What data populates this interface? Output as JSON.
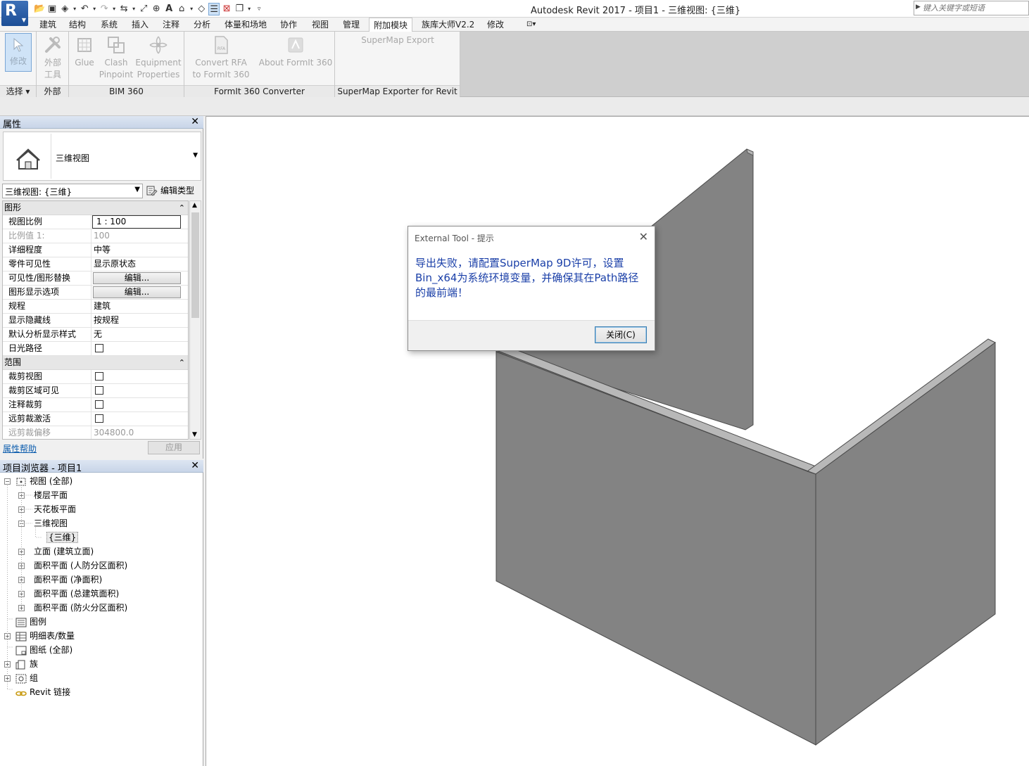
{
  "app": {
    "title": "Autodesk Revit 2017 -      项目1 - 三维视图: {三维}",
    "logo_letter": "R",
    "search_placeholder": "键入关键字或短语"
  },
  "ribbon_tabs": [
    "建筑",
    "结构",
    "系统",
    "插入",
    "注释",
    "分析",
    "体量和场地",
    "协作",
    "视图",
    "管理",
    "附加模块",
    "族库大师V2.2",
    "修改"
  ],
  "ribbon_selected_tab": "附加模块",
  "ribbon": {
    "modify_label": "修改",
    "select_panel": "选择",
    "external_tools_line1": "外部",
    "external_tools_line2": "工具",
    "external_panel": "外部",
    "glue": "Glue",
    "clash_line1": "Clash",
    "clash_line2": "Pinpoint",
    "equip_line1": "Equipment",
    "equip_line2": "Properties",
    "bim360_panel": "BIM 360",
    "convert_line1": "Convert RFA",
    "convert_line2": "to FormIt 360",
    "about_formit": "About FormIt 360",
    "formit_panel": "FormIt 360 Converter",
    "supermap_export": "SuperMap Export",
    "supermap_panel": "SuperMap Exporter for Revit"
  },
  "properties": {
    "title": "属性",
    "type_name": "三维视图",
    "instance": "三维视图: {三维}",
    "edit_type": "编辑类型",
    "groups": {
      "graphics": "图形",
      "extents": "范围"
    },
    "rows": {
      "view_scale": {
        "label": "视图比例",
        "value": "1 : 100"
      },
      "scale_value": {
        "label": "比例值 1:",
        "value": "100"
      },
      "detail_level": {
        "label": "详细程度",
        "value": "中等"
      },
      "parts_visibility": {
        "label": "零件可见性",
        "value": "显示原状态"
      },
      "vg_overrides": {
        "label": "可见性/图形替换",
        "value": "编辑..."
      },
      "graphic_display": {
        "label": "图形显示选项",
        "value": "编辑..."
      },
      "discipline": {
        "label": "规程",
        "value": "建筑"
      },
      "hidden_lines": {
        "label": "显示隐藏线",
        "value": "按规程"
      },
      "analysis_style": {
        "label": "默认分析显示样式",
        "value": "无"
      },
      "sun_path": {
        "label": "日光路径"
      },
      "crop_view": {
        "label": "裁剪视图"
      },
      "crop_visible": {
        "label": "裁剪区域可见"
      },
      "annotation_crop": {
        "label": "注释裁剪"
      },
      "far_clip_active": {
        "label": "远剪裁激活"
      },
      "far_clip_offset": {
        "label": "远剪裁偏移",
        "value": "304800.0"
      }
    },
    "help": "属性帮助",
    "apply": "应用"
  },
  "browser": {
    "title": "项目浏览器 - 项目1",
    "nodes": {
      "views": "视图 (全部)",
      "floor_plans": "楼层平面",
      "ceiling_plans": "天花板平面",
      "views_3d": "三维视图",
      "view_3d": "{三维}",
      "elevations": "立面 (建筑立面)",
      "area_civil": "面积平面 (人防分区面积)",
      "area_net": "面积平面 (净面积)",
      "area_gross": "面积平面 (总建筑面积)",
      "area_fire": "面积平面 (防火分区面积)",
      "legends": "图例",
      "schedules": "明细表/数量",
      "sheets": "图纸 (全部)",
      "families": "族",
      "groups": "组",
      "revit_links": "Revit 链接"
    }
  },
  "dialog": {
    "title": "External Tool - 提示",
    "message": "导出失败，请配置SuperMap 9D许可，设置Bin_x64为系统环境变量，并确保其在Path路径的最前端！",
    "close_button": "关闭(C)"
  },
  "colors": {
    "wall_face": "#838383",
    "wall_edge": "#4a4a4a",
    "accent": "#1a3fa8"
  }
}
